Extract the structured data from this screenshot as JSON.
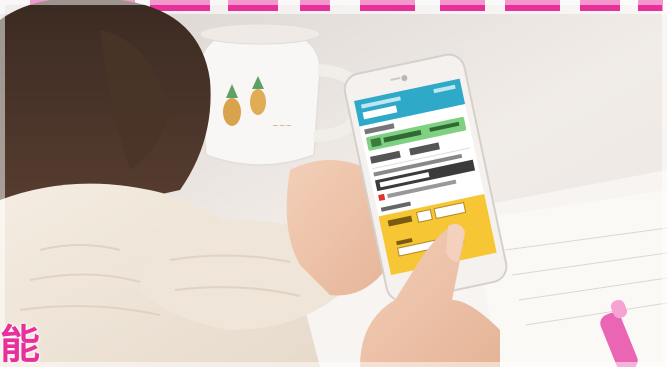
{
  "image": {
    "description_colors": {
      "banner": "#e7309a",
      "phone_header": "#2fa9c8",
      "phone_green": "#7fd081",
      "phone_dark_band": "#3b3b3b",
      "phone_yellow_panel": "#f6c634"
    }
  },
  "caption_char": "能"
}
